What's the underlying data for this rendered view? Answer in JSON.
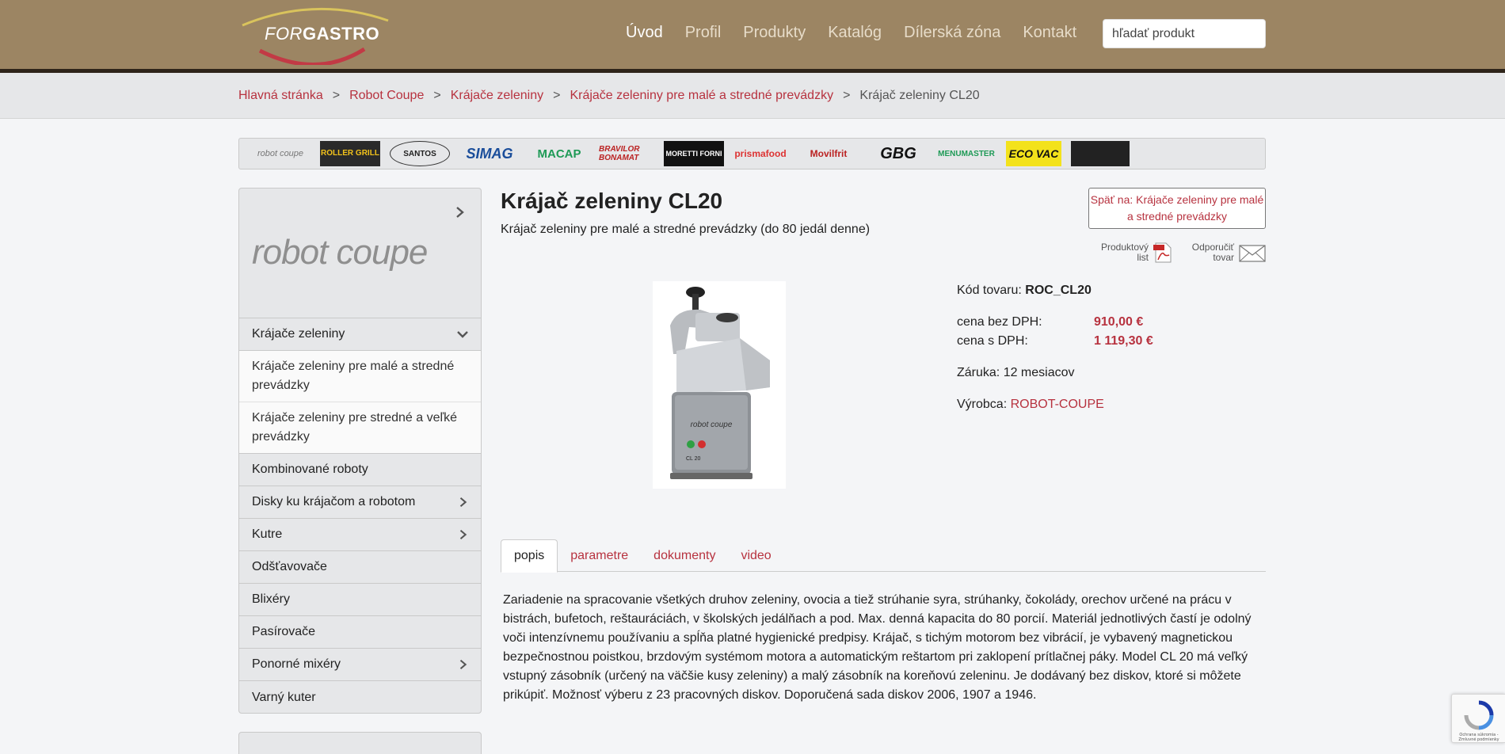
{
  "header": {
    "logo_text_thin": "FOR",
    "logo_text_bold": "GASTRO",
    "nav": [
      {
        "label": "Úvod",
        "active": true
      },
      {
        "label": "Profil"
      },
      {
        "label": "Produkty"
      },
      {
        "label": "Katalóg"
      },
      {
        "label": "Dílerská zóna"
      },
      {
        "label": "Kontakt"
      }
    ],
    "search_placeholder": "hľadať produkt"
  },
  "breadcrumb": {
    "items": [
      "Hlavná stránka",
      "Robot Coupe",
      "Krájače zeleniny",
      "Krájače zeleniny pre malé a stredné prevádzky"
    ],
    "current": "Krájač zeleniny CL20",
    "separator": ">"
  },
  "brands": [
    "robot coupe",
    "ROLLER GRILL",
    "SANTOS",
    "SIMAG",
    "MACAP",
    "BRAVILOR BONAMAT",
    "MORETTI FORNI",
    "prismafood",
    "Movilfrit",
    "GBG",
    "MENUMASTER",
    "ECO VAC",
    ""
  ],
  "sidebar": {
    "brand_logo": "robot coupe",
    "items": [
      {
        "label": "Krájače zeleniny",
        "expanded": true
      },
      {
        "label": "Krájače zeleniny pre malé a stredné prevádzky",
        "sub": true
      },
      {
        "label": "Krájače zeleniny pre stredné a veľké prevádzky",
        "sub": true
      },
      {
        "label": "Kombinované roboty"
      },
      {
        "label": "Disky ku krájačom a robotom",
        "has_children": true
      },
      {
        "label": "Kutre",
        "has_children": true
      },
      {
        "label": "Odšťavovače"
      },
      {
        "label": "Blixéry"
      },
      {
        "label": "Pasírovače"
      },
      {
        "label": "Ponorné mixéry",
        "has_children": true
      },
      {
        "label": "Varný kuter"
      }
    ]
  },
  "product": {
    "title": "Krájač zeleniny CL20",
    "subtitle": "Krájač zeleniny pre malé a stredné prevádzky (do 80 jedál denne)",
    "back_button": "Späť na: Krájače zeleniny pre malé a stredné prevádzky",
    "doc_pdf_label": "Produktový list",
    "doc_mail_label": "Odporučiť tovar",
    "code_label": "Kód tovaru:",
    "code": "ROC_CL20",
    "price_net_label": "cena bez DPH:",
    "price_net": "910,00 €",
    "price_gross_label": "cena s DPH:",
    "price_gross": "1 119,30 €",
    "warranty": "Záruka: 12 mesiacov",
    "maker_label": "Výrobca:",
    "maker": "ROBOT-COUPE",
    "image_brand": "robot coupe",
    "image_model": "CL 20"
  },
  "tabs": [
    {
      "label": "popis",
      "active": true
    },
    {
      "label": "parametre"
    },
    {
      "label": "dokumenty"
    },
    {
      "label": "video"
    }
  ],
  "description": "Zariadenie na spracovanie všetkých druhov zeleniny, ovocia a tiež strúhanie syra, strúhanky, čokolády, orechov určené na prácu v bistrách, bufetoch, reštauráciách, v školských jedálňach a pod. Max. denná kapacita do 80 porcií. Materiál jednotlivých častí je odolný voči intenzívnemu používaniu a spĺňa platné hygienické predpisy. Krájač, s tichým motorom bez vibrácií, je vybavený magnetickou bezpečnostnou poistkou, brzdovým systémom motora a automatickým reštartom pri zaklopení prítlačnej páky. Model CL 20 má veľký vstupný zásobník (určený na väčšie kusy zeleniny) a malý zásobník na koreňovú zeleninu. Je dodávaný bez diskov, ktoré si môžete prikúpiť. Možnosť výberu z 23 pracovných diskov. Doporučená sada diskov 2006, 1907 a 1946.",
  "recaptcha": "Ochrana súkromia - Zmluvné podmienky",
  "colors": {
    "header": "#9c8563",
    "accent": "#b7323f",
    "sidebar": "#e6e7e9"
  }
}
